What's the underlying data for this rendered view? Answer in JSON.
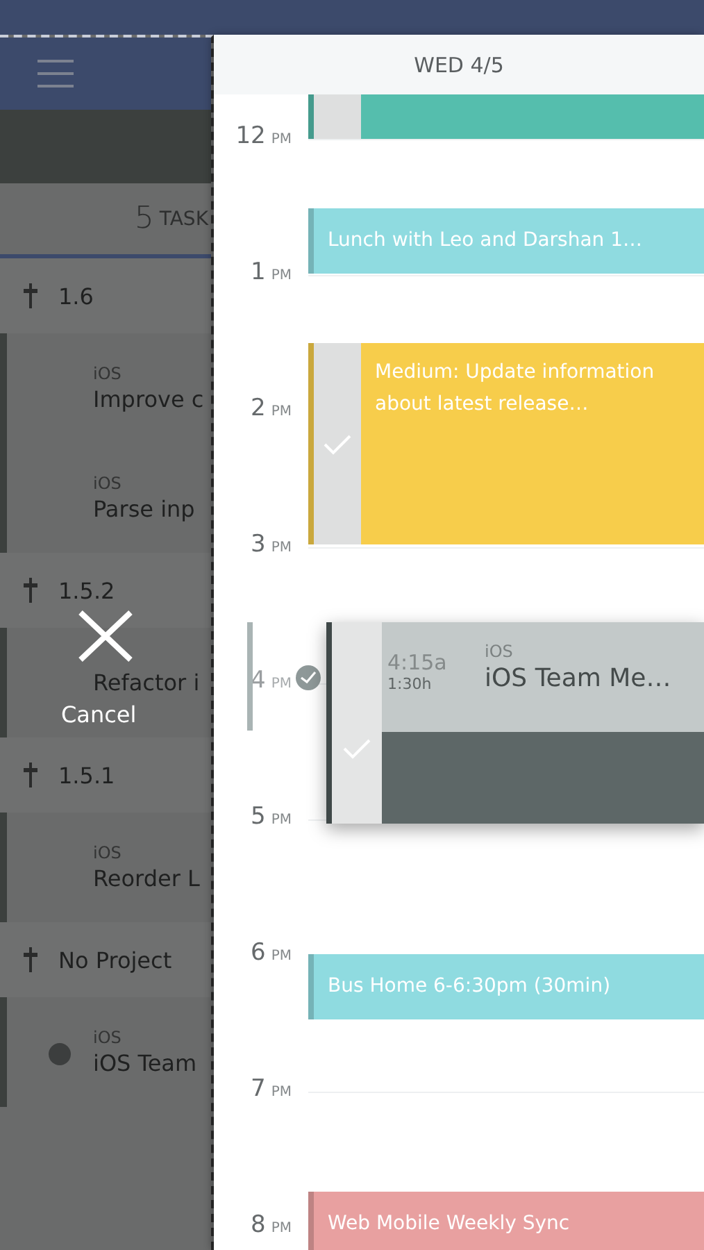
{
  "sidebar": {
    "task_count": "5",
    "task_count_label": "TASK",
    "items": [
      {
        "kind": "project",
        "label": "1.6"
      },
      {
        "kind": "task",
        "project": "iOS",
        "title": "Improve c",
        "dot": false
      },
      {
        "kind": "task",
        "project": "iOS",
        "title": "Parse inp",
        "dot": false
      },
      {
        "kind": "project",
        "label": "1.5.2"
      },
      {
        "kind": "task",
        "title": "Refactor i",
        "dot": false
      },
      {
        "kind": "project",
        "label": "1.5.1"
      },
      {
        "kind": "task",
        "project": "iOS",
        "title": "Reorder L",
        "dot": false
      },
      {
        "kind": "project",
        "label": "No Project"
      },
      {
        "kind": "task",
        "project": "iOS",
        "title": "iOS Team",
        "dot": true
      }
    ]
  },
  "cancel": {
    "label": "Cancel"
  },
  "day": {
    "title": "WED 4/5",
    "hours": [
      {
        "hour": "12",
        "period": "PM",
        "dimmed": false
      },
      {
        "hour": "1",
        "period": "PM",
        "dimmed": false
      },
      {
        "hour": "2",
        "period": "PM",
        "dimmed": false
      },
      {
        "hour": "3",
        "period": "PM",
        "dimmed": false
      },
      {
        "hour": "4",
        "period": "PM",
        "dimmed": true
      },
      {
        "hour": "5",
        "period": "PM",
        "dimmed": false
      },
      {
        "hour": "6",
        "period": "PM",
        "dimmed": false
      },
      {
        "hour": "7",
        "period": "PM",
        "dimmed": false
      },
      {
        "hour": "8",
        "period": "PM",
        "dimmed": false
      }
    ],
    "events": [
      {
        "kind": "task",
        "color": "#55bead",
        "done": false
      },
      {
        "kind": "event",
        "title": "Lunch with Leo and Darshan 1…",
        "color": "#8fdbe0"
      },
      {
        "kind": "task",
        "title": "Medium: Update information about latest release…",
        "color": "#f7cd4b",
        "done": true
      },
      {
        "kind": "dragging",
        "time": "4:15a",
        "duration": "1:30h",
        "project": "iOS",
        "title": "iOS Team Me…",
        "color": "#5d6767",
        "done": true
      },
      {
        "kind": "event",
        "title": "Bus Home 6-6:30pm (30min)",
        "color": "#8fdbe0"
      },
      {
        "kind": "event",
        "title": "Web Mobile Weekly Sync",
        "color": "#e8a0a0"
      }
    ]
  }
}
